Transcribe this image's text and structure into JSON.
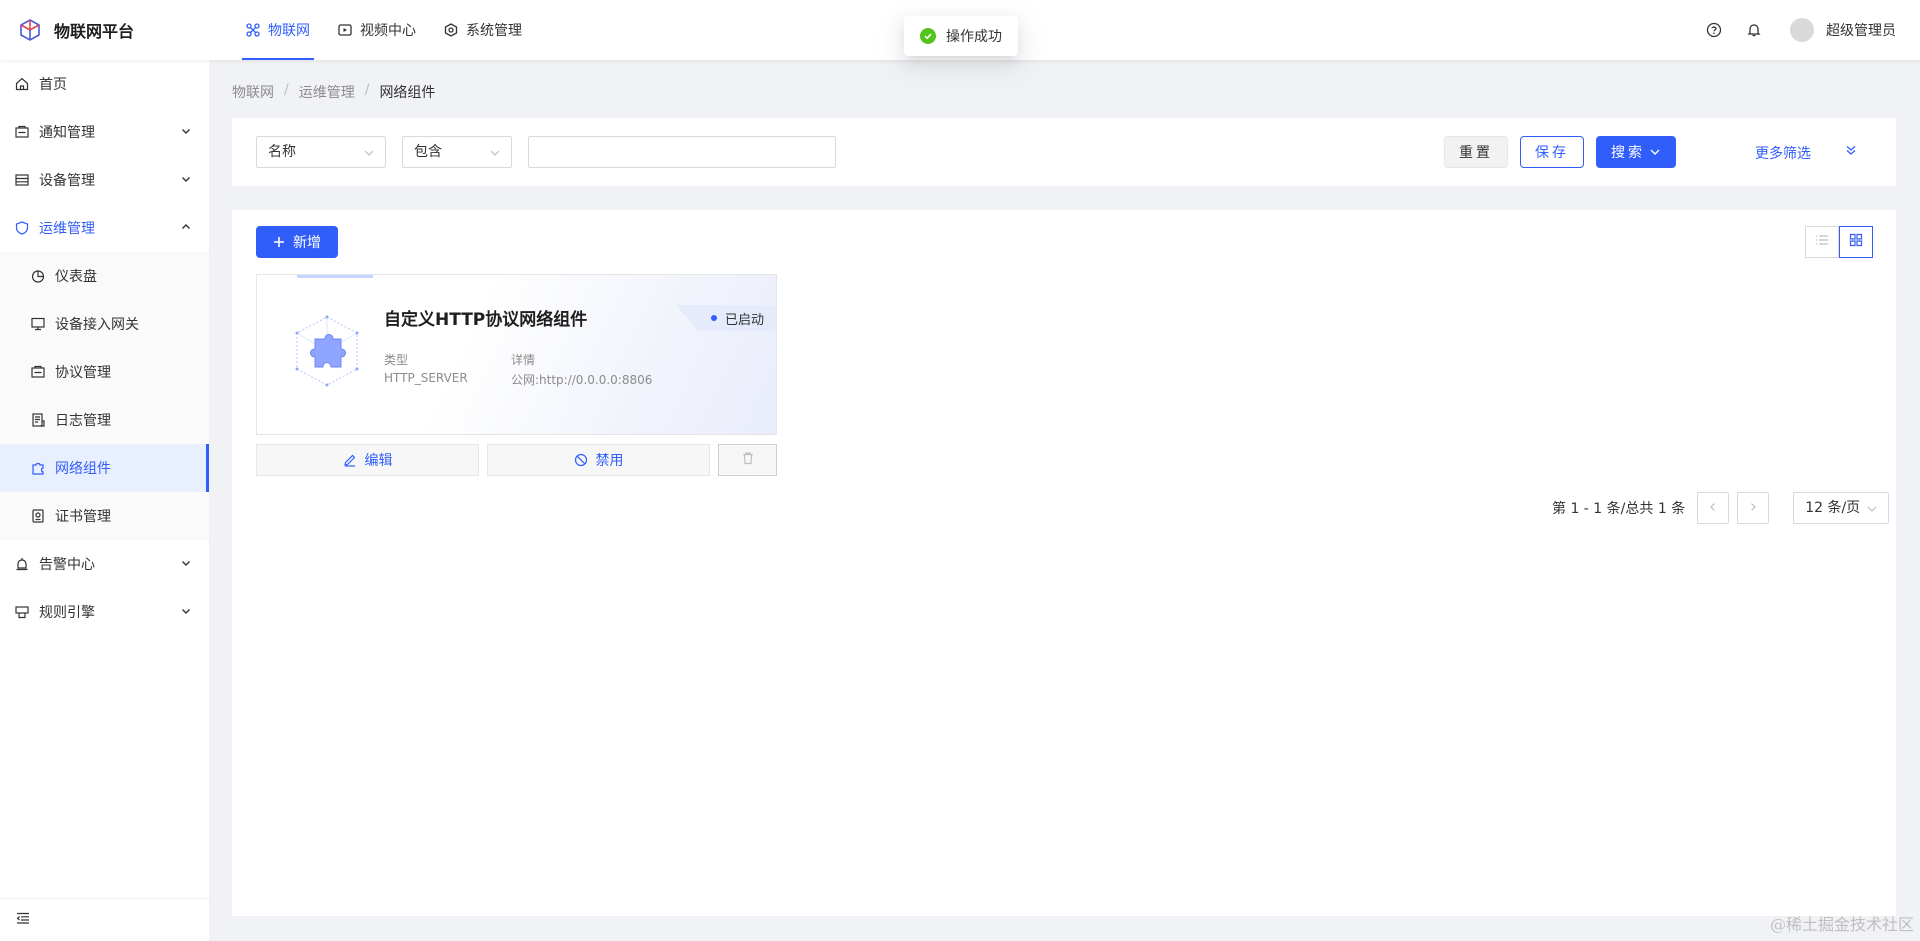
{
  "header": {
    "brand": "物联网平台",
    "nav": [
      {
        "label": "物联网",
        "icon": "iot-icon",
        "active": true
      },
      {
        "label": "视频中心",
        "icon": "video-icon",
        "active": false
      },
      {
        "label": "系统管理",
        "icon": "system-icon",
        "active": false
      }
    ],
    "user": "超级管理员"
  },
  "toast": {
    "text": "操作成功"
  },
  "sidebar": {
    "items": [
      {
        "label": "首页",
        "icon": "home-icon"
      },
      {
        "label": "通知管理",
        "icon": "notice-icon"
      },
      {
        "label": "设备管理",
        "icon": "device-icon"
      },
      {
        "label": "运维管理",
        "icon": "ops-icon",
        "open": true
      },
      {
        "label": "告警中心",
        "icon": "alarm-icon"
      },
      {
        "label": "规则引擎",
        "icon": "rule-icon"
      }
    ],
    "sub": [
      {
        "label": "仪表盘",
        "icon": "dashboard-icon"
      },
      {
        "label": "设备接入网关",
        "icon": "gateway-icon"
      },
      {
        "label": "协议管理",
        "icon": "protocol-icon"
      },
      {
        "label": "日志管理",
        "icon": "log-icon"
      },
      {
        "label": "网络组件",
        "icon": "network-icon",
        "selected": true
      },
      {
        "label": "证书管理",
        "icon": "certificate-icon"
      }
    ]
  },
  "breadcrumb": [
    "物联网",
    "运维管理",
    "网络组件"
  ],
  "filter": {
    "field": "名称",
    "operator": "包含",
    "value": "",
    "reset": "重置",
    "save": "保存",
    "search": "搜索",
    "more": "更多筛选"
  },
  "main": {
    "add": "新增",
    "card": {
      "title": "自定义HTTP协议网络组件",
      "status": "已启动",
      "type_label": "类型",
      "type_value": "HTTP_SERVER",
      "detail_label": "详情",
      "detail_value": "公网:http://0.0.0.0:8806",
      "edit": "编辑",
      "disable": "禁用"
    },
    "pagination": {
      "total": "第 1 - 1 条/总共 1 条",
      "size": "12 条/页"
    }
  },
  "watermark": "@稀土掘金技术社区",
  "colors": {
    "primary": "#315efb",
    "success": "#52c41a"
  }
}
